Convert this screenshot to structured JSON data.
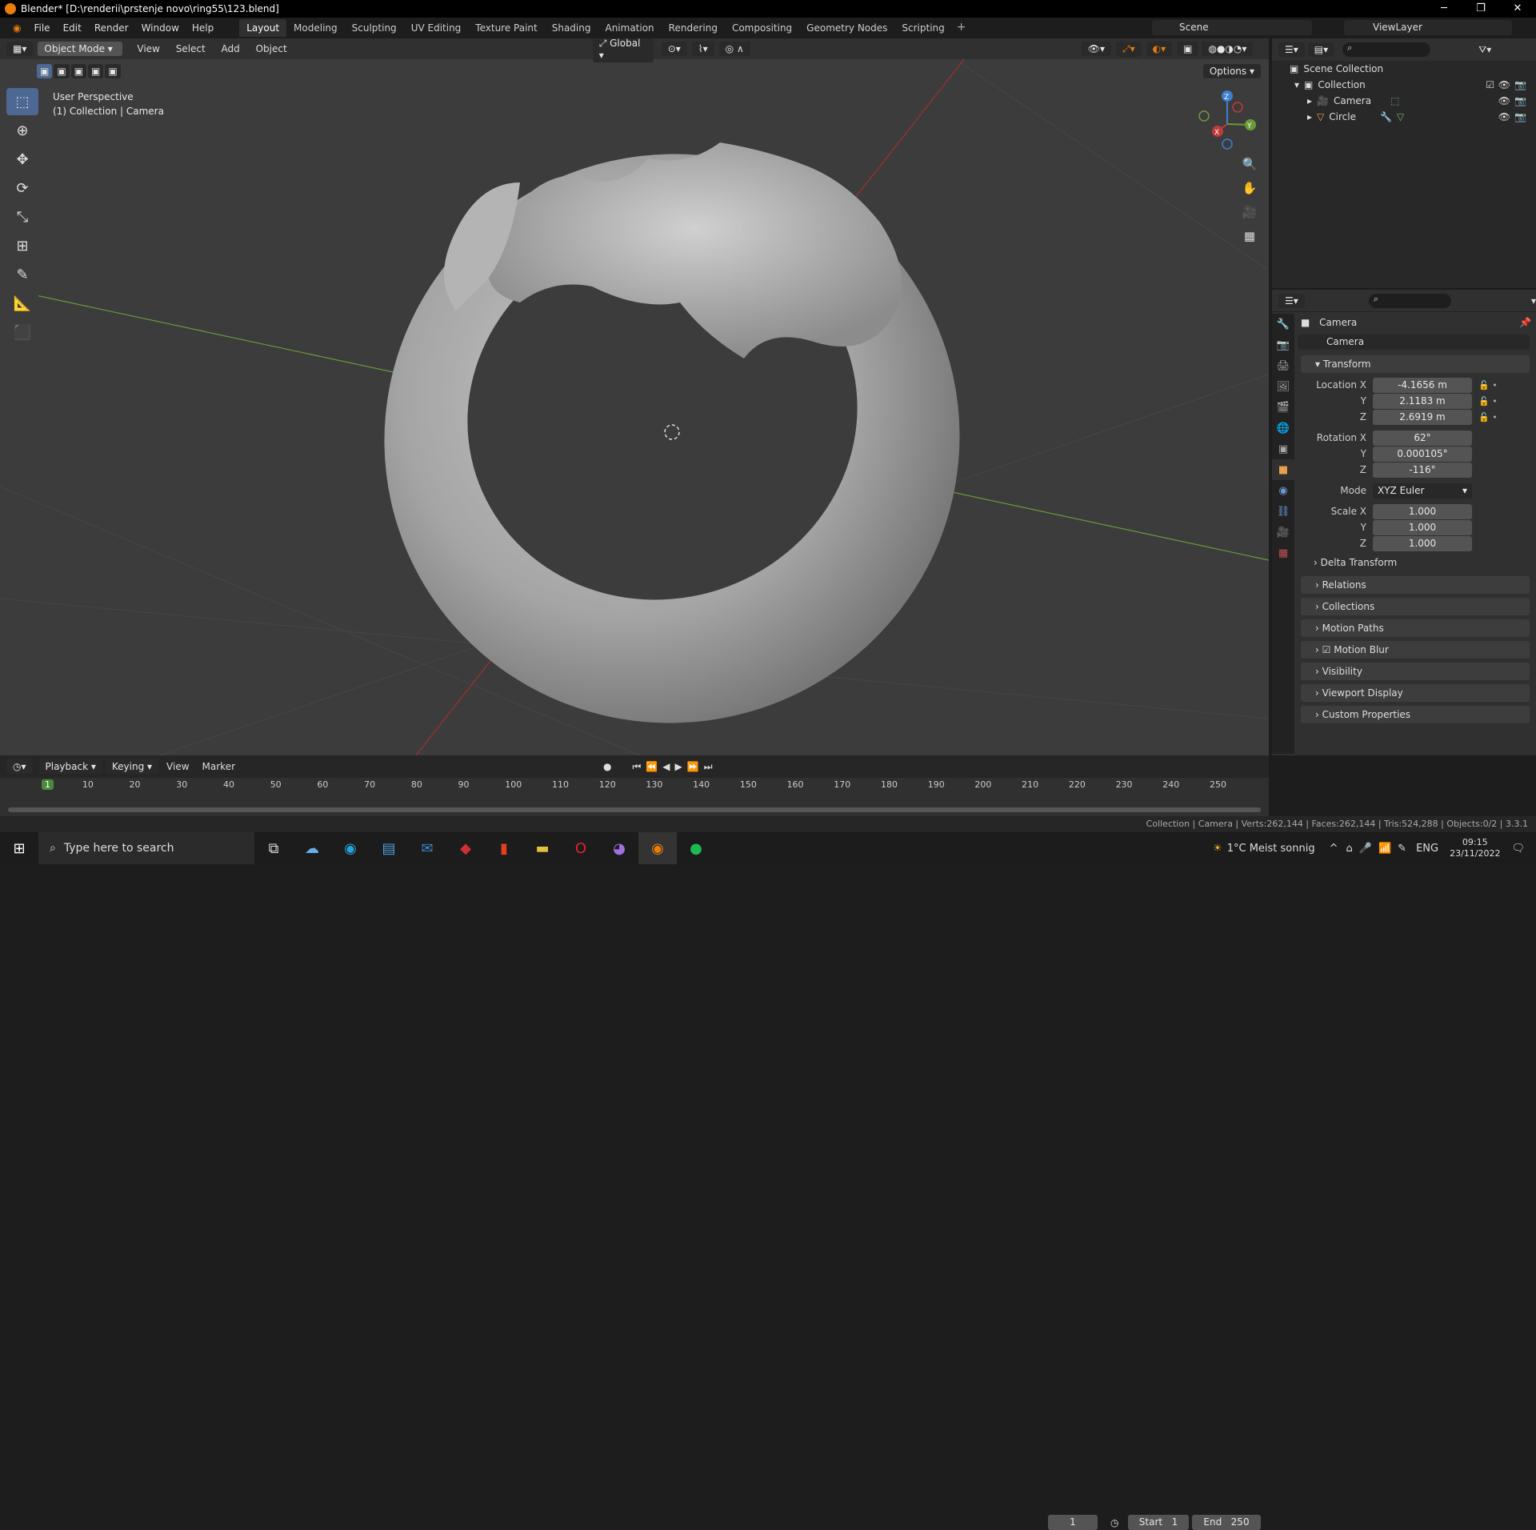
{
  "window": {
    "title": "Blender* [D:\\renderii\\prstenje novo\\ring55\\123.blend]"
  },
  "menu": [
    "File",
    "Edit",
    "Render",
    "Window",
    "Help"
  ],
  "workspaces": [
    "Layout",
    "Modeling",
    "Sculpting",
    "UV Editing",
    "Texture Paint",
    "Shading",
    "Animation",
    "Rendering",
    "Compositing",
    "Geometry Nodes",
    "Scripting"
  ],
  "scene_name": "Scene",
  "view_layer": "ViewLayer",
  "viewport": {
    "mode": "Object Mode",
    "menus": [
      "View",
      "Select",
      "Add",
      "Object"
    ],
    "transform_orientation": "Global",
    "options_label": "Options",
    "info_line1": "User Perspective",
    "info_line2": "(1) Collection | Camera",
    "gizmo": {
      "z": "Z",
      "y": "Y",
      "x": "X"
    }
  },
  "outliner": {
    "root": "Scene Collection",
    "collection": "Collection",
    "items": [
      "Camera",
      "Circle"
    ]
  },
  "properties": {
    "object_name": "Camera",
    "data_name": "Camera",
    "transform_label": "Transform",
    "location_label": "Location X",
    "location": [
      "-4.1656 m",
      "2.1183 m",
      "2.6919 m"
    ],
    "rotation_label": "Rotation X",
    "rotation": [
      "62°",
      "0.000105°",
      "-116°"
    ],
    "mode_label": "Mode",
    "mode_value": "XYZ Euler",
    "scale_label": "Scale X",
    "scale": [
      "1.000",
      "1.000",
      "1.000"
    ],
    "y": "Y",
    "z": "Z",
    "delta": "Delta Transform",
    "panels": [
      "Relations",
      "Collections",
      "Motion Paths",
      "Motion Blur",
      "Visibility",
      "Viewport Display",
      "Custom Properties"
    ]
  },
  "timeline": {
    "menus": [
      "Playback",
      "Keying",
      "View",
      "Marker"
    ],
    "current_frame": "1",
    "start_label": "Start",
    "start": "1",
    "end_label": "End",
    "end": "250",
    "ticks": [
      "1",
      "10",
      "20",
      "30",
      "40",
      "50",
      "60",
      "70",
      "80",
      "90",
      "100",
      "110",
      "120",
      "130",
      "140",
      "150",
      "160",
      "170",
      "180",
      "190",
      "200",
      "210",
      "220",
      "230",
      "240",
      "250"
    ]
  },
  "status": {
    "text": "Collection | Camera | Verts:262,144 | Faces:262,144 | Tris:524,288 | Objects:0/2 | 3.3.1"
  },
  "taskbar": {
    "search_placeholder": "Type here to search",
    "weather": "1°C  Meist sonnig",
    "lang": "ENG",
    "time": "09:15",
    "date": "23/11/2022"
  },
  "colors": {
    "accent": "#4d6892",
    "orange": "#e87d0d",
    "x_axis": "#a03030",
    "y_axis": "#6a9a3a"
  }
}
